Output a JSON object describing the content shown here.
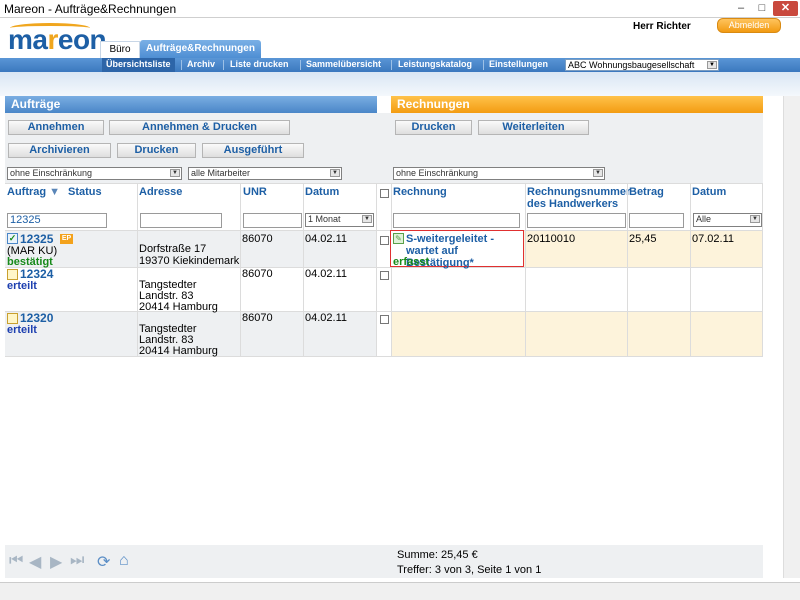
{
  "window": {
    "title": "Mareon - Aufträge&Rechnungen",
    "min": "–",
    "max": "□",
    "close": "✕"
  },
  "header": {
    "logo_pre": "ma",
    "logo_o": "r",
    "logo_post": "eon",
    "user": "Herr Richter",
    "logout": "Abmelden",
    "tabs": [
      "Büro",
      "Aufträge&Rechnungen"
    ]
  },
  "nav": {
    "items": [
      "Übersichtsliste",
      "Archiv",
      "Liste drucken",
      "Sammelübersicht",
      "Leistungskatalog",
      "Einstellungen"
    ],
    "company": "ABC Wohnungsbaugesellschaft"
  },
  "left": {
    "title": "Aufträge",
    "buttons": [
      "Annehmen",
      "Annehmen & Drucken",
      "Archivieren",
      "Drucken",
      "Ausgeführt"
    ],
    "filter1": "ohne Einschränkung",
    "filter2": "alle Mitarbeiter",
    "cols": [
      "Auftrag",
      "Status",
      "Adresse",
      "UNR",
      "Datum"
    ],
    "search": "12325",
    "date_filter": "1 Monat"
  },
  "right": {
    "title": "Rechnungen",
    "buttons": [
      "Drucken",
      "Weiterleiten"
    ],
    "filter": "ohne Einschränkung",
    "cols": [
      "Rechnung",
      "Rechnungsnummer des Handwerkers",
      "Betrag",
      "Datum"
    ],
    "date_filter": "Alle"
  },
  "rows": [
    {
      "nr": "12325",
      "sub": "(MAR KU)",
      "status": "bestätigt",
      "addr1": "Dorfstraße 17",
      "addr2": "19370 Kiekindemark",
      "addr3": "",
      "unr": "86070",
      "date": "04.02.11",
      "inv_status": "S-weitergeleitet - wartet auf Bestätigung*",
      "inv_sub": "erfasst",
      "inv_nr": "20110010",
      "amount": "25,45",
      "inv_date": "07.02.11",
      "badge": "EP"
    },
    {
      "nr": "12324",
      "sub": "",
      "status": "erteilt",
      "addr1": "Tangstedter",
      "addr2": "Landstr. 83",
      "addr3": "20414 Hamburg",
      "unr": "86070",
      "date": "04.02.11"
    },
    {
      "nr": "12320",
      "sub": "",
      "status": "erteilt",
      "addr1": "Tangstedter",
      "addr2": "Landstr. 83",
      "addr3": "20414 Hamburg",
      "unr": "86070",
      "date": "04.02.11"
    }
  ],
  "footer": {
    "summe": "Summe: 25,45 €",
    "treffer": "Treffer: 3 von 3,  Seite 1 von 1"
  },
  "icons": [
    "first-page-icon",
    "prev-page-icon",
    "next-page-icon",
    "last-page-icon",
    "refresh-icon",
    "home-icon"
  ],
  "colors": {
    "accent_blue": "#4a86c8",
    "accent_orange": "#f39c12",
    "link_blue": "#1d5fa5",
    "status_green": "#178a1a"
  }
}
